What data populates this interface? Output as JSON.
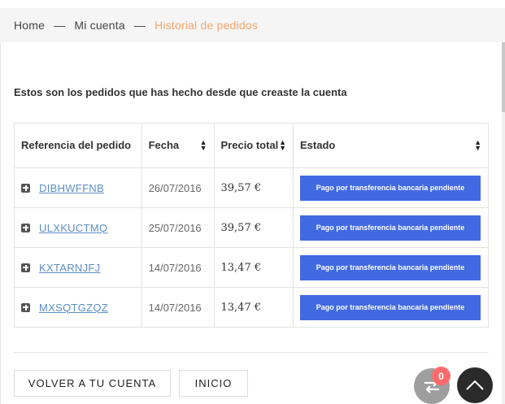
{
  "breadcrumb": {
    "items": [
      "Home",
      "Mi cuenta"
    ],
    "separator": "—",
    "current": "Historial de pedidos"
  },
  "intro": "Estos son los pedidos que has hecho desde que creaste la cuenta",
  "table": {
    "headers": {
      "reference": "Referencia del pedido",
      "date": "Fecha",
      "price": "Precio total",
      "status": "Estado"
    },
    "rows": [
      {
        "reference": "DIBHWFFNB",
        "date": "26/07/2016",
        "price": "39,57 €",
        "status": "Pago por transferencia bancaria pendiente"
      },
      {
        "reference": "ULXKUCTMQ",
        "date": "25/07/2016",
        "price": "39,57 €",
        "status": "Pago por transferencia bancaria pendiente"
      },
      {
        "reference": "KXTARNJFJ",
        "date": "14/07/2016",
        "price": "13,47 €",
        "status": "Pago por transferencia bancaria pendiente"
      },
      {
        "reference": "MXSQTGZQZ",
        "date": "14/07/2016",
        "price": "13,47 €",
        "status": "Pago por transferencia bancaria pendiente"
      }
    ]
  },
  "buttons": {
    "back": "VOLVER A TU CUENTA",
    "home": "INICIO"
  },
  "compare": {
    "count": "0",
    "icon": "compare-arrows-icon"
  },
  "scroll_top": {
    "icon": "chevron-up-icon"
  },
  "colors": {
    "status_badge": "#4169e1",
    "breadcrumb_current": "#f5a66b",
    "link": "#5b8ec7",
    "compare_badge": "#ff6b6b"
  }
}
